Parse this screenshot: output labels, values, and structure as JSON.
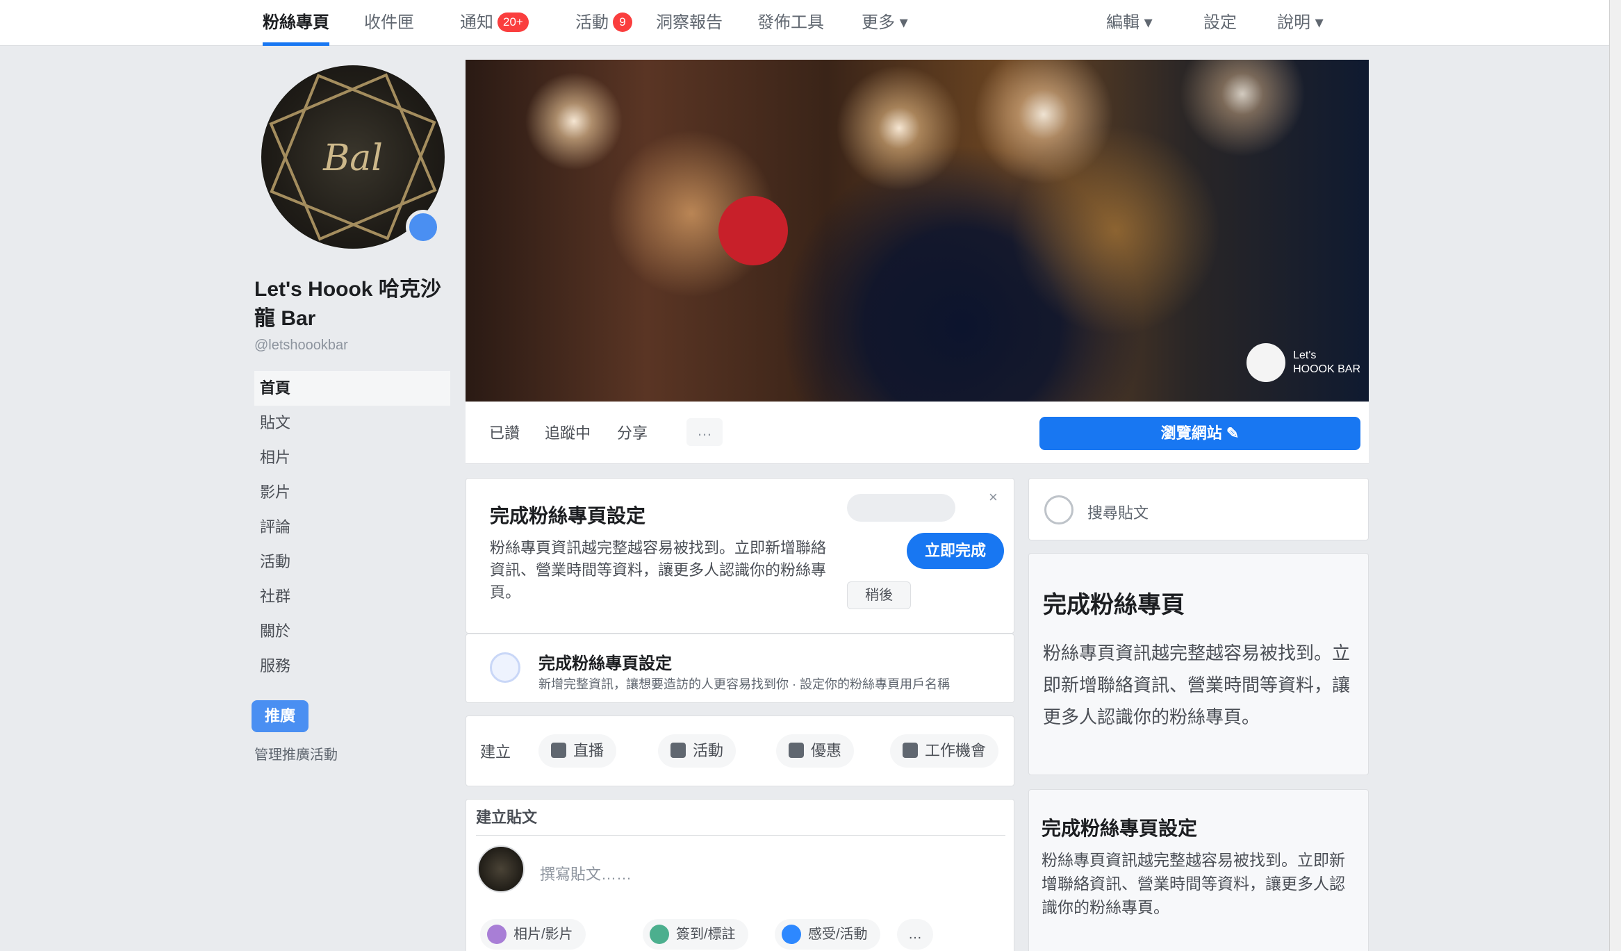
{
  "nav": {
    "items": [
      {
        "label": "粉絲專頁"
      },
      {
        "label": "收件匣"
      },
      {
        "label": "通知",
        "badge": "20+"
      },
      {
        "label": "活動",
        "badge": "9"
      },
      {
        "label": "洞察報告"
      },
      {
        "label": "發佈工具"
      },
      {
        "label": "更多 ▾"
      }
    ],
    "right_items": [
      {
        "label": "編輯 ▾"
      },
      {
        "label": "設定"
      },
      {
        "label": "說明 ▾"
      }
    ]
  },
  "page": {
    "name": "Let's Hoook 哈克沙龍 Bar",
    "handle": "@letshoookbar",
    "avatar_text": "Bal",
    "menu": [
      "首頁",
      "貼文",
      "相片",
      "影片",
      "評論",
      "活動",
      "社群",
      "關於",
      "服務"
    ],
    "promote_label": "推廣",
    "promote_link": "管理推廣活動"
  },
  "cover": {
    "logo_line1": "Let's",
    "logo_line2": "HOOOK BAR"
  },
  "actions": {
    "items": [
      "已讚",
      "追蹤中",
      "分享",
      "…"
    ],
    "cta": "瀏覽網站 ✎"
  },
  "promo_card": {
    "title": "完成粉絲專頁設定",
    "text": "粉絲專頁資訊越完整越容易被找到。立即新增聯絡資訊、營業時間等資料，讓更多人認識你的粉絲專頁。",
    "primary": "立即完成",
    "secondary": "稍後",
    "close": "×"
  },
  "tip_row": {
    "title": "完成粉絲專頁設定",
    "text": "新增完整資訊，讓想要造訪的人更容易找到你 · 設定你的粉絲專頁用戶名稱"
  },
  "toolbar": {
    "label": "建立",
    "items": [
      "直播",
      "活動",
      "優惠",
      "工作機會"
    ]
  },
  "composer": {
    "heading": "建立貼文",
    "placeholder": "撰寫貼文……",
    "chips": [
      "相片/影片",
      "簽到/標註",
      "感受/活動",
      "…"
    ]
  },
  "right_col": {
    "search_placeholder": "搜尋貼文",
    "card1": {
      "title": "完成粉絲專頁",
      "text": "粉絲專頁資訊越完整越容易被找到。立即新增聯絡資訊、營業時間等資料，讓更多人認識你的粉絲專頁。"
    },
    "card2": {
      "title": "完成粉絲專頁設定",
      "text": "粉絲專頁資訊越完整越容易被找到。立即新增聯絡資訊、營業時間等資料，讓更多人認識你的粉絲專頁。"
    }
  },
  "colors": {
    "accent": "#1877f2",
    "background": "#e9ebee",
    "badge": "#fa3e3e"
  }
}
